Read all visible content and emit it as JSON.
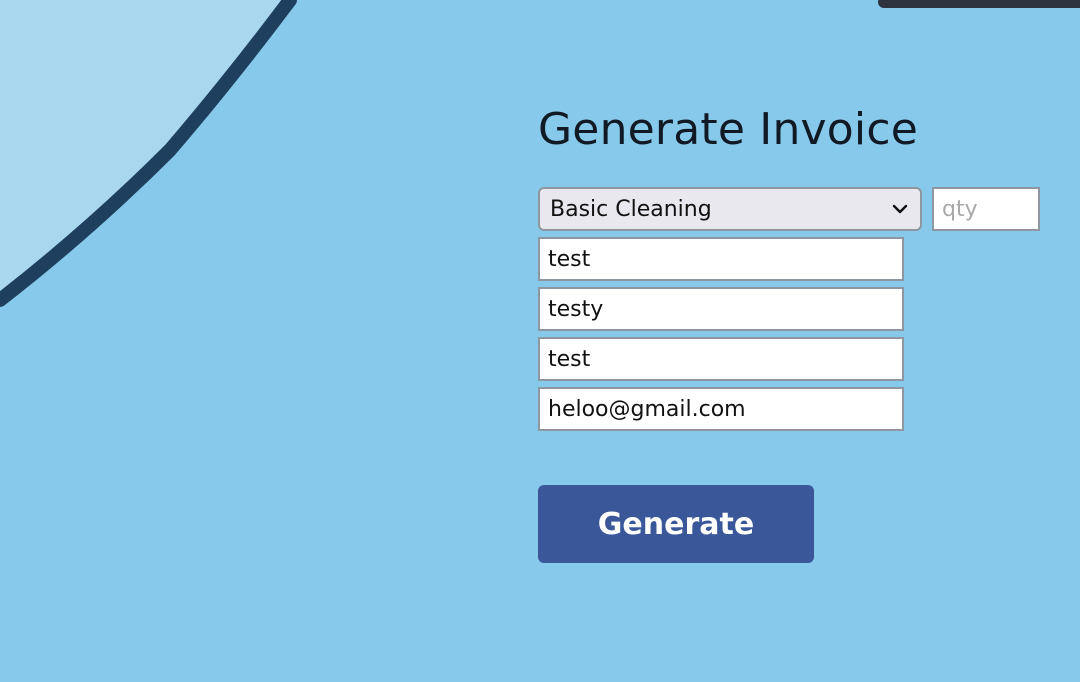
{
  "header": {
    "title": "Generate Invoice"
  },
  "form": {
    "service_select": {
      "selected": "Basic Cleaning"
    },
    "qty": {
      "value": "",
      "placeholder": "qty"
    },
    "fields": [
      {
        "value": "test"
      },
      {
        "value": "testy"
      },
      {
        "value": "test"
      },
      {
        "value": "heloo@gmail.com"
      }
    ],
    "generate_label": "Generate"
  },
  "colors": {
    "background": "#87c9ea",
    "shape_light": "#a9d8ee",
    "shape_edge": "#1f3f5f",
    "button": "#3a5799"
  }
}
